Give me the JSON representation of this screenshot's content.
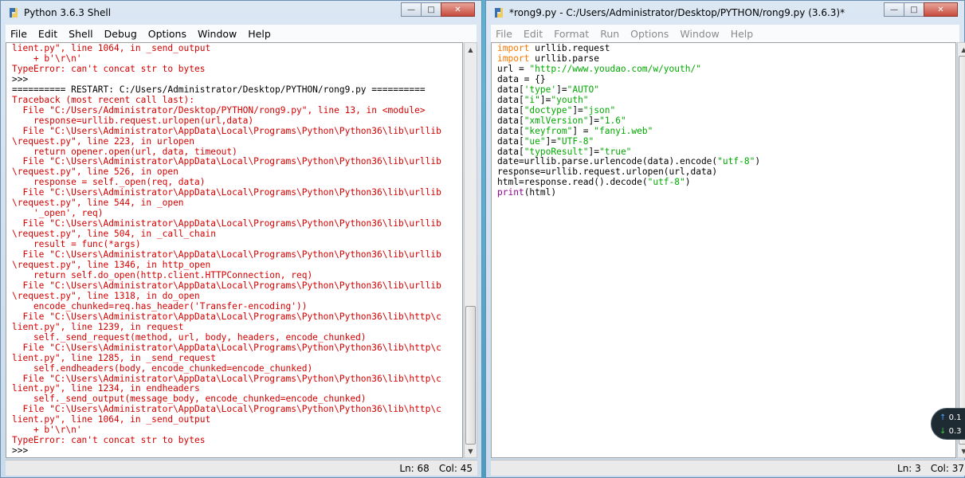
{
  "shell": {
    "title": "Python 3.6.3 Shell",
    "menu": [
      "File",
      "Edit",
      "Shell",
      "Debug",
      "Options",
      "Window",
      "Help"
    ],
    "lines": [
      {
        "t": "lient.py\", line 1064, in _send_output",
        "c": "err"
      },
      {
        "t": "    + b'\\r\\n'",
        "c": "err"
      },
      {
        "t": "TypeError: can't concat str to bytes",
        "c": "err"
      },
      {
        "t": ">>> ",
        "c": ""
      },
      {
        "t": "========== RESTART: C:/Users/Administrator/Desktop/PYTHON/rong9.py ==========",
        "c": ""
      },
      {
        "t": "Traceback (most recent call last):",
        "c": "err"
      },
      {
        "t": "  File \"C:/Users/Administrator/Desktop/PYTHON/rong9.py\", line 13, in <module>",
        "c": "err"
      },
      {
        "t": "    response=urllib.request.urlopen(url,data)",
        "c": "err"
      },
      {
        "t": "  File \"C:\\Users\\Administrator\\AppData\\Local\\Programs\\Python\\Python36\\lib\\urllib",
        "c": "err"
      },
      {
        "t": "\\request.py\", line 223, in urlopen",
        "c": "err"
      },
      {
        "t": "    return opener.open(url, data, timeout)",
        "c": "err"
      },
      {
        "t": "  File \"C:\\Users\\Administrator\\AppData\\Local\\Programs\\Python\\Python36\\lib\\urllib",
        "c": "err"
      },
      {
        "t": "\\request.py\", line 526, in open",
        "c": "err"
      },
      {
        "t": "    response = self._open(req, data)",
        "c": "err"
      },
      {
        "t": "  File \"C:\\Users\\Administrator\\AppData\\Local\\Programs\\Python\\Python36\\lib\\urllib",
        "c": "err"
      },
      {
        "t": "\\request.py\", line 544, in _open",
        "c": "err"
      },
      {
        "t": "    '_open', req)",
        "c": "err"
      },
      {
        "t": "  File \"C:\\Users\\Administrator\\AppData\\Local\\Programs\\Python\\Python36\\lib\\urllib",
        "c": "err"
      },
      {
        "t": "\\request.py\", line 504, in _call_chain",
        "c": "err"
      },
      {
        "t": "    result = func(*args)",
        "c": "err"
      },
      {
        "t": "  File \"C:\\Users\\Administrator\\AppData\\Local\\Programs\\Python\\Python36\\lib\\urllib",
        "c": "err"
      },
      {
        "t": "\\request.py\", line 1346, in http_open",
        "c": "err"
      },
      {
        "t": "    return self.do_open(http.client.HTTPConnection, req)",
        "c": "err"
      },
      {
        "t": "  File \"C:\\Users\\Administrator\\AppData\\Local\\Programs\\Python\\Python36\\lib\\urllib",
        "c": "err"
      },
      {
        "t": "\\request.py\", line 1318, in do_open",
        "c": "err"
      },
      {
        "t": "    encode_chunked=req.has_header('Transfer-encoding'))",
        "c": "err"
      },
      {
        "t": "  File \"C:\\Users\\Administrator\\AppData\\Local\\Programs\\Python\\Python36\\lib\\http\\c",
        "c": "err"
      },
      {
        "t": "lient.py\", line 1239, in request",
        "c": "err"
      },
      {
        "t": "    self._send_request(method, url, body, headers, encode_chunked)",
        "c": "err"
      },
      {
        "t": "  File \"C:\\Users\\Administrator\\AppData\\Local\\Programs\\Python\\Python36\\lib\\http\\c",
        "c": "err"
      },
      {
        "t": "lient.py\", line 1285, in _send_request",
        "c": "err"
      },
      {
        "t": "    self.endheaders(body, encode_chunked=encode_chunked)",
        "c": "err"
      },
      {
        "t": "  File \"C:\\Users\\Administrator\\AppData\\Local\\Programs\\Python\\Python36\\lib\\http\\c",
        "c": "err"
      },
      {
        "t": "lient.py\", line 1234, in endheaders",
        "c": "err"
      },
      {
        "t": "    self._send_output(message_body, encode_chunked=encode_chunked)",
        "c": "err"
      },
      {
        "t": "  File \"C:\\Users\\Administrator\\AppData\\Local\\Programs\\Python\\Python36\\lib\\http\\c",
        "c": "err"
      },
      {
        "t": "lient.py\", line 1064, in _send_output",
        "c": "err"
      },
      {
        "t": "    + b'\\r\\n'",
        "c": "err"
      },
      {
        "t": "TypeError: can't concat str to bytes",
        "c": "err"
      },
      {
        "t": ">>> ",
        "c": ""
      }
    ],
    "status": {
      "ln": "Ln: 68",
      "col": "Col: 45"
    }
  },
  "editor": {
    "title": "*rong9.py - C:/Users/Administrator/Desktop/PYTHON/rong9.py (3.6.3)*",
    "menu": [
      "File",
      "Edit",
      "Format",
      "Run",
      "Options",
      "Window",
      "Help"
    ],
    "lines": [
      [
        {
          "t": "import",
          "c": "kw"
        },
        {
          "t": " urllib.request",
          "c": ""
        }
      ],
      [
        {
          "t": "import",
          "c": "kw"
        },
        {
          "t": " urllib.parse",
          "c": ""
        }
      ],
      [
        {
          "t": "url = ",
          "c": ""
        },
        {
          "t": "\"http://www.youdao.com/w/youth/\"",
          "c": "str"
        }
      ],
      [
        {
          "t": "data = {}",
          "c": ""
        }
      ],
      [
        {
          "t": "data[",
          "c": ""
        },
        {
          "t": "'type'",
          "c": "str"
        },
        {
          "t": "]=",
          "c": ""
        },
        {
          "t": "\"AUTO\"",
          "c": "str"
        }
      ],
      [
        {
          "t": "data[",
          "c": ""
        },
        {
          "t": "\"i\"",
          "c": "str"
        },
        {
          "t": "]=",
          "c": ""
        },
        {
          "t": "\"youth\"",
          "c": "str"
        }
      ],
      [
        {
          "t": "data[",
          "c": ""
        },
        {
          "t": "\"doctype\"",
          "c": "str"
        },
        {
          "t": "]=",
          "c": ""
        },
        {
          "t": "\"json\"",
          "c": "str"
        }
      ],
      [
        {
          "t": "data[",
          "c": ""
        },
        {
          "t": "\"xmlVersion\"",
          "c": "str"
        },
        {
          "t": "]=",
          "c": ""
        },
        {
          "t": "\"1.6\"",
          "c": "str"
        }
      ],
      [
        {
          "t": "data[",
          "c": ""
        },
        {
          "t": "\"keyfrom\"",
          "c": "str"
        },
        {
          "t": "] = ",
          "c": ""
        },
        {
          "t": "\"fanyi.web\"",
          "c": "str"
        }
      ],
      [
        {
          "t": "data[",
          "c": ""
        },
        {
          "t": "\"ue\"",
          "c": "str"
        },
        {
          "t": "]=",
          "c": ""
        },
        {
          "t": "\"UTF-8\"",
          "c": "str"
        }
      ],
      [
        {
          "t": "data[",
          "c": ""
        },
        {
          "t": "\"typoResult\"",
          "c": "str"
        },
        {
          "t": "]=",
          "c": ""
        },
        {
          "t": "\"true\"",
          "c": "str"
        }
      ],
      [
        {
          "t": "date=urllib.parse.urlencode(data).encode(",
          "c": ""
        },
        {
          "t": "\"utf-8\"",
          "c": "str"
        },
        {
          "t": ")",
          "c": ""
        }
      ],
      [
        {
          "t": "response=urllib.request.urlopen(url,data)",
          "c": ""
        }
      ],
      [
        {
          "t": "html=response.read().decode(",
          "c": ""
        },
        {
          "t": "\"utf-8\"",
          "c": "str"
        },
        {
          "t": ")",
          "c": ""
        }
      ],
      [
        {
          "t": "print",
          "c": "bi"
        },
        {
          "t": "(html)",
          "c": ""
        }
      ]
    ],
    "status": {
      "ln": "Ln: 3",
      "col": "Col: 37"
    }
  },
  "net_widget": {
    "up": "0.1",
    "down": "0.3"
  },
  "colors": {
    "error": "#d40000",
    "keyword": "#ff7700",
    "string": "#00aa00",
    "builtin": "#900090"
  },
  "icons": {
    "window_minimize": "minimize-icon",
    "window_maximize": "maximize-icon",
    "window_close": "close-icon",
    "app": "python-idle-icon"
  }
}
